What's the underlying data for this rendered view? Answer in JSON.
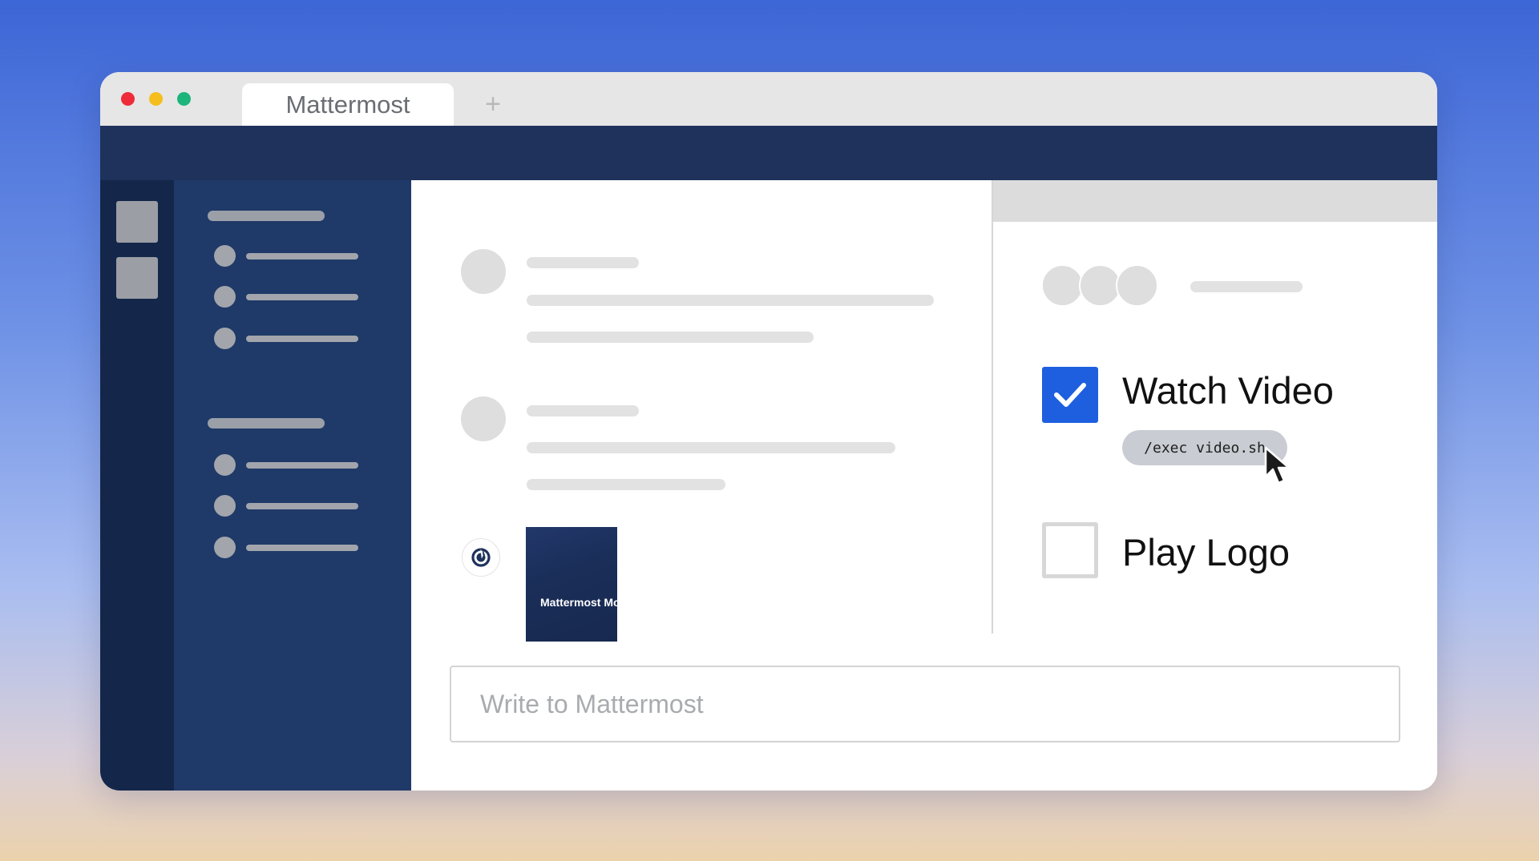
{
  "browser": {
    "tab_title": "Mattermost",
    "new_tab_symbol": "+",
    "traffic_lights": {
      "close": "#ee2b39",
      "minimize": "#f5be1c",
      "zoom": "#1db57b"
    }
  },
  "colors": {
    "topbar": "#1e325c",
    "team_sidebar": "#14274a",
    "channel_sidebar": "#1f3a68",
    "accent_checkbox": "#1e5fe0"
  },
  "feed": {
    "bot_icon": "mattermost-logo-icon",
    "video_thumbnail_text": "Mattermost Mo"
  },
  "checklist": {
    "items": [
      {
        "label": "Watch Video",
        "checked": true,
        "command": "/exec video.sh"
      },
      {
        "label": "Play Logo",
        "checked": false
      }
    ]
  },
  "composer": {
    "placeholder": "Write to Mattermost"
  }
}
